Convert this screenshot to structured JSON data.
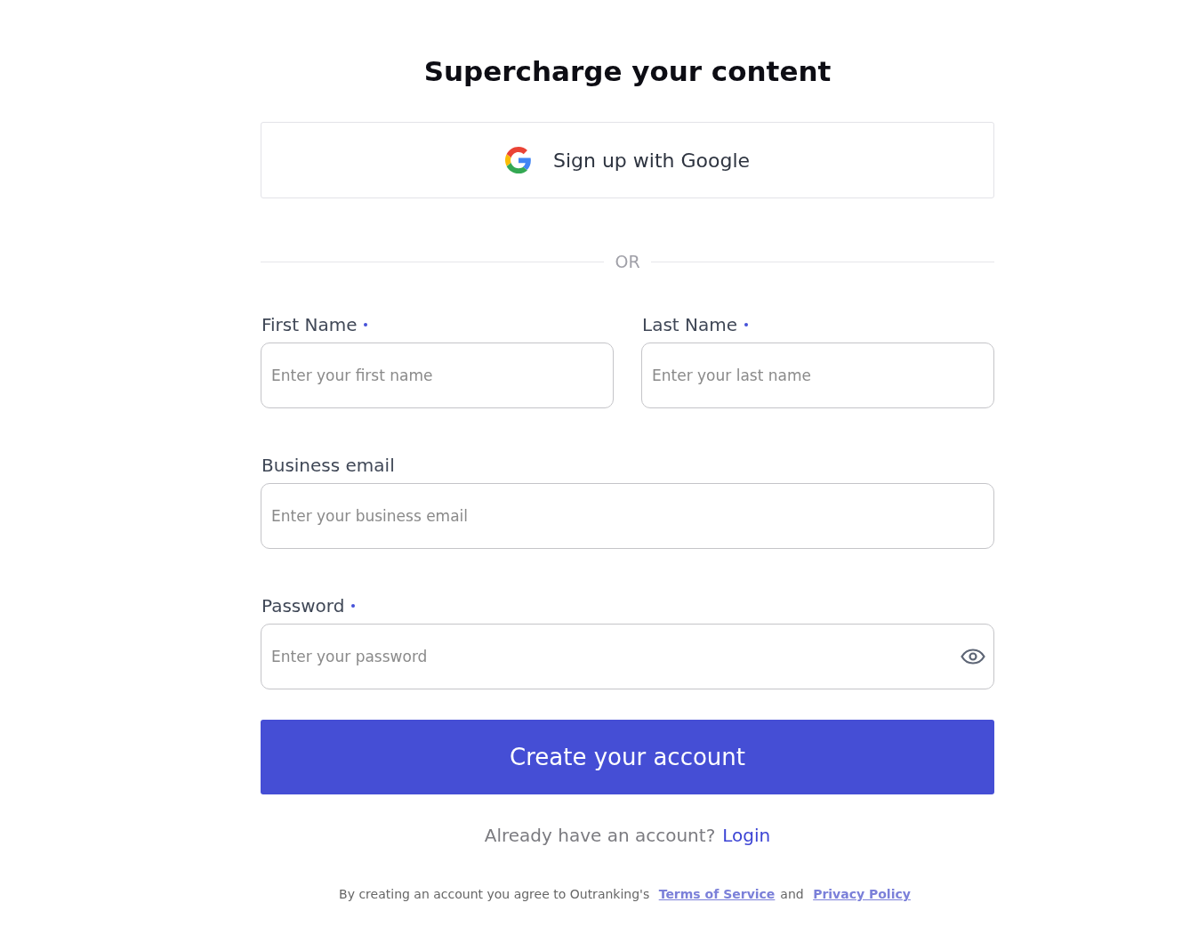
{
  "title": "Supercharge your content",
  "google_button": {
    "label": "Sign up with Google"
  },
  "divider": {
    "label": "OR"
  },
  "fields": [
    {
      "label": "First Name",
      "placeholder": "Enter your first name",
      "required": true,
      "kind": "text"
    },
    {
      "label": "Last Name",
      "placeholder": "Enter your last name",
      "required": true,
      "kind": "text"
    },
    {
      "label": "Business email",
      "placeholder": "Enter your business email",
      "required": false,
      "kind": "text"
    },
    {
      "label": "Password",
      "placeholder": "Enter your password",
      "required": true,
      "kind": "password"
    }
  ],
  "submit_button": {
    "label": "Create your account"
  },
  "login_prompt": {
    "text": "Already have an account?",
    "link": "Login"
  },
  "legal": {
    "text": "By creating an account you agree to Outranking's",
    "terms_link": "Terms of Service",
    "joiner": "and",
    "privacy_link": "Privacy Policy"
  }
}
